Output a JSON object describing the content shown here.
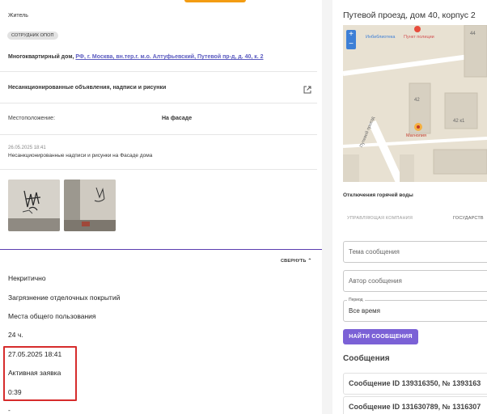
{
  "left": {
    "role": "Житель",
    "badge": "СОТРУДНИК ОПОП",
    "address_label": "Многоквартирный дом,",
    "address_link": "РФ, г. Москва, вн.тер.г. м.о. Алтуфьевский, Путевой пр-д, д. 40, к. 2",
    "problem_title": "Несанкционированные объявления, надписи и рисунки",
    "location_label": "Местоположение:",
    "location_value": "На фасаде",
    "report_date": "26.05.2025 18:41",
    "report_text": "Несанкционированные надписи и рисунки на Фасаде дома",
    "collapse_label": "СВЕРНУТЬ",
    "details": [
      "Некритично",
      "Загрязнение отделочных покрытий",
      "Места общего пользования",
      "24 ч.",
      "27.05.2025 18:41",
      "Активная заявка",
      "0:39",
      "-"
    ]
  },
  "right": {
    "title": "Путевой проезд, дом 40, корпус 2",
    "map": {
      "zoom_in": "+",
      "zoom_out": "−",
      "labels": {
        "library": "Инбиблиотека",
        "police": "Пункт полиции",
        "house44": "44",
        "house42": "42",
        "house42k1": "42 к1",
        "shop": "Магнолия",
        "street": "Путевой проезд"
      }
    },
    "outage": "Отключения горячей воды",
    "tabs": [
      "УПРАВЛЯЮЩАЯ КОМПАНИЯ",
      "ГОСУДАРСТВ"
    ],
    "subject_placeholder": "Тема сообщения",
    "author_placeholder": "Автор сообщения",
    "period_legend": "Период",
    "period_value": "Все время",
    "find_button": "НАЙТИ СООБЩЕНИЯ",
    "messages_heading": "Сообщения",
    "messages": [
      "Сообщение ID 139316350, № 1393163",
      "Сообщение ID 131630789, № 1316307"
    ]
  }
}
